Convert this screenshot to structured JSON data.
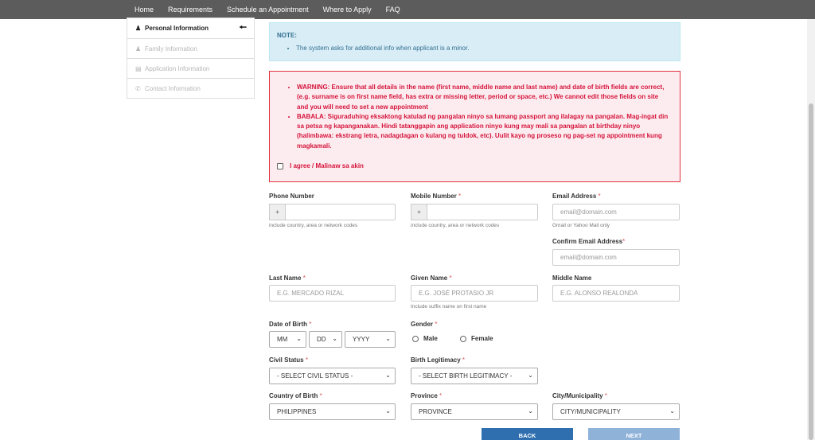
{
  "nav": [
    "Home",
    "Requirements",
    "Schedule an Appointment",
    "Where to Apply",
    "FAQ"
  ],
  "sidebar": {
    "items": [
      {
        "label": "Personal Information",
        "icon": "user-icon"
      },
      {
        "label": "Family Information",
        "icon": "users-icon"
      },
      {
        "label": "Application Information",
        "icon": "card-icon"
      },
      {
        "label": "Contact Information",
        "icon": "phone-icon"
      }
    ]
  },
  "note": {
    "title": "NOTE:",
    "items": [
      "The system asks for additional info when applicant is a minor."
    ]
  },
  "warning": {
    "items": [
      "WARNING: Ensure that all details in the name (first name, middle name and last name) and date of birth fields are correct, (e.g. surname is on first name field, has extra or missing letter, period or space, etc.) We cannot edit those fields on site and you will need to set a new appointment",
      "BABALA: Siguraduhing eksaktong katulad ng pangalan ninyo sa lumang passport ang ilalagay na pangalan. Mag-ingat din sa petsa ng kapanganakan. Hindi tatanggapin ang application ninyo kung may mali sa pangalan at birthday ninyo (halimbawa: ekstrang letra, nadagdagan o kulang ng tuldok, etc). Uulit kayo ng proseso ng pag-set ng appointment kung magkamali."
    ],
    "agree_label": "I agree / Malinaw sa akin"
  },
  "form": {
    "phone": {
      "label": "Phone Number",
      "prefix": "+",
      "value": "",
      "help": "include country, area or network codes"
    },
    "mobile": {
      "label": "Mobile Number",
      "required": "*",
      "prefix": "+",
      "value": "",
      "help": "include country, area or network codes"
    },
    "email": {
      "label": "Email Address",
      "required": "*",
      "placeholder": "email@domain.com",
      "help": "Gmail or Yahoo Mail only"
    },
    "confirm_email": {
      "label": "Confirm Email Address",
      "required": "*",
      "placeholder": "email@domain.com"
    },
    "last_name": {
      "label": "Last Name",
      "required": "*",
      "placeholder": "E.G. MERCADO RIZAL"
    },
    "given_name": {
      "label": "Given Name",
      "required": "*",
      "placeholder": "E.G. JOSÉ PROTASIO JR",
      "help": "Include suffix name on first name"
    },
    "middle_name": {
      "label": "Middle Name",
      "placeholder": "E.G. ALONSO REALONDA"
    },
    "dob": {
      "label": "Date of Birth",
      "required": "*",
      "mm": "MM",
      "dd": "DD",
      "yyyy": "YYYY"
    },
    "gender": {
      "label": "Gender",
      "required": "*",
      "options": [
        "Male",
        "Female"
      ]
    },
    "civil_status": {
      "label": "Civil Status",
      "required": "*",
      "value": "- SELECT CIVIL STATUS -"
    },
    "birth_legitimacy": {
      "label": "Birth Legitimacy",
      "required": "*",
      "value": "- SELECT BIRTH LEGITIMACY -"
    },
    "country_of_birth": {
      "label": "Country of Birth",
      "required": "*",
      "value": "PHILIPPINES"
    },
    "province": {
      "label": "Province",
      "required": "*",
      "value": "PROVINCE"
    },
    "city": {
      "label": "City/Municipality",
      "required": "*",
      "value": "CITY/MUNICIPALITY"
    }
  },
  "buttons": {
    "back": "BACK",
    "next": "NEXT"
  }
}
